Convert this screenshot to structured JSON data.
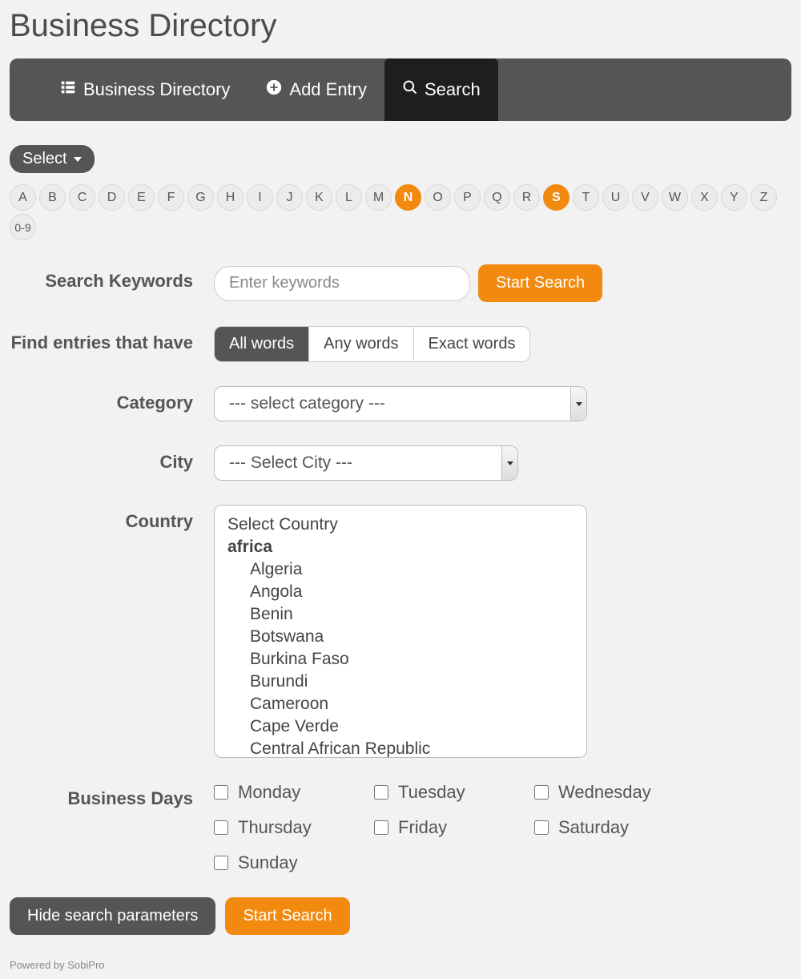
{
  "title": "Business Directory",
  "nav": {
    "directory": "Business Directory",
    "add": "Add Entry",
    "search": "Search"
  },
  "select_pill": "Select",
  "alpha": [
    "A",
    "B",
    "C",
    "D",
    "E",
    "F",
    "G",
    "H",
    "I",
    "J",
    "K",
    "L",
    "M",
    "N",
    "O",
    "P",
    "Q",
    "R",
    "S",
    "T",
    "U",
    "V",
    "W",
    "X",
    "Y",
    "Z",
    "0-9"
  ],
  "alpha_active": [
    "N",
    "S"
  ],
  "labels": {
    "keywords": "Search Keywords",
    "find": "Find entries that have",
    "category": "Category",
    "city": "City",
    "country": "Country",
    "days": "Business Days"
  },
  "keywords_placeholder": "Enter keywords",
  "start_search": "Start Search",
  "segments": {
    "all": "All words",
    "any": "Any words",
    "exact": "Exact words"
  },
  "category_placeholder": "--- select category ---",
  "city_placeholder": "--- Select City ---",
  "country": {
    "prompt": "Select Country",
    "group": "africa",
    "items": [
      "Algeria",
      "Angola",
      "Benin",
      "Botswana",
      "Burkina Faso",
      "Burundi",
      "Cameroon",
      "Cape Verde",
      "Central African Republic"
    ]
  },
  "days": [
    "Monday",
    "Tuesday",
    "Wednesday",
    "Thursday",
    "Friday",
    "Saturday",
    "Sunday"
  ],
  "hide_params": "Hide search parameters",
  "footer": "Powered by SobiPro"
}
